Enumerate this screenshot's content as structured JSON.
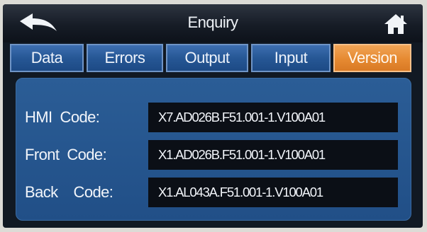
{
  "header": {
    "title": "Enquiry",
    "back_icon": "back-arrow-icon",
    "home_icon": "home-icon"
  },
  "tabs": [
    {
      "label": "Data",
      "active": false
    },
    {
      "label": "Errors",
      "active": false
    },
    {
      "label": "Output",
      "active": false
    },
    {
      "label": "Input",
      "active": false
    },
    {
      "label": "Version",
      "active": true
    }
  ],
  "version": {
    "rows": [
      {
        "label": "HMI  Code:",
        "value": "X7.AD026B.F51.001-1.V100A01"
      },
      {
        "label": "Front  Code:",
        "value": "X1.AD026B.F51.001-1.V100A01"
      },
      {
        "label": "Back    Code:",
        "value": "X1.AL043A.F51.001-1.V100A01"
      }
    ]
  },
  "colors": {
    "tab_active": "#e68a32",
    "tab_inactive": "#265795",
    "panel": "#2b5d96",
    "value_field": "#0b0f16",
    "titlebar": "#161c26"
  }
}
